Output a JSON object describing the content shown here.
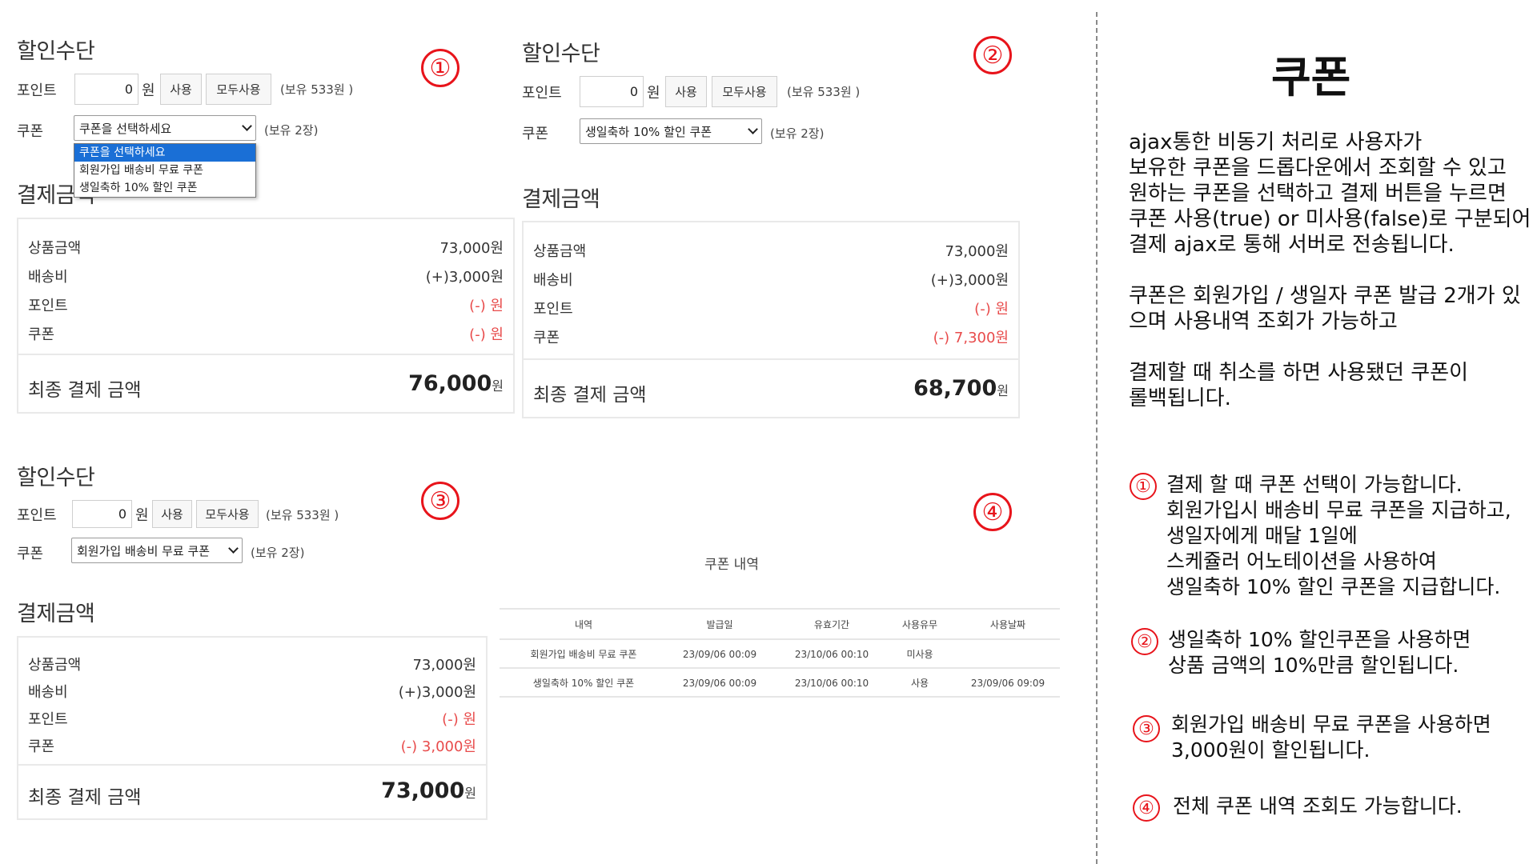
{
  "panel1": {
    "discount_title": "할인수단",
    "point_label": "포인트",
    "point_value": "0",
    "won": "원",
    "use_btn": "사용",
    "use_all_btn": "모두사용",
    "point_hold": "(보유 533원 )",
    "coupon_label": "쿠폰",
    "coupon_selected": "쿠폰을 선택하세요",
    "coupon_hold": "(보유 2장)",
    "dropdown_options": [
      "쿠폰을 선택하세요",
      "회원가입 배송비 무료 쿠폰",
      "생일축하 10% 할인 쿠폰"
    ],
    "payment_title": "결제금액",
    "rows": [
      {
        "label": "상품금액",
        "value": "73,000원"
      },
      {
        "label": "배송비",
        "value": "(+)3,000원"
      },
      {
        "label": "포인트",
        "value": "(-) 원"
      },
      {
        "label": "쿠폰",
        "value": "(-) 원"
      }
    ],
    "final_label": "최종 결제 금액",
    "final_amount": "76,000",
    "final_unit": "원"
  },
  "panel2": {
    "discount_title": "할인수단",
    "point_label": "포인트",
    "point_value": "0",
    "won": "원",
    "use_btn": "사용",
    "use_all_btn": "모두사용",
    "point_hold": "(보유 533원 )",
    "coupon_label": "쿠폰",
    "coupon_selected": "생일축하 10% 할인 쿠폰",
    "coupon_hold": "(보유 2장)",
    "payment_title": "결제금액",
    "rows": [
      {
        "label": "상품금액",
        "value": "73,000원"
      },
      {
        "label": "배송비",
        "value": "(+)3,000원"
      },
      {
        "label": "포인트",
        "value": "(-) 원"
      },
      {
        "label": "쿠폰",
        "value": "(-) 7,300원"
      }
    ],
    "final_label": "최종 결제 금액",
    "final_amount": "68,700",
    "final_unit": "원"
  },
  "panel3": {
    "discount_title": "할인수단",
    "point_label": "포인트",
    "point_value": "0",
    "won": "원",
    "use_btn": "사용",
    "use_all_btn": "모두사용",
    "point_hold": "(보유 533원 )",
    "coupon_label": "쿠폰",
    "coupon_selected": "회원가입 배송비 무료 쿠폰",
    "coupon_hold": "(보유 2장)",
    "payment_title": "결제금액",
    "rows": [
      {
        "label": "상품금액",
        "value": "73,000원"
      },
      {
        "label": "배송비",
        "value": "(+)3,000원"
      },
      {
        "label": "포인트",
        "value": "(-) 원"
      },
      {
        "label": "쿠폰",
        "value": "(-) 3,000원"
      }
    ],
    "final_label": "최종 결제 금액",
    "final_amount": "73,000",
    "final_unit": "원"
  },
  "history": {
    "title": "쿠폰 내역",
    "headers": [
      "내역",
      "발급일",
      "유효기간",
      "사용유무",
      "사용날짜"
    ],
    "rows": [
      [
        "회원가입 배송비 무료 쿠폰",
        "23/09/06 00:09",
        "23/10/06 00:10",
        "미사용",
        ""
      ],
      [
        "생일축하 10% 할인 쿠폰",
        "23/09/06 00:09",
        "23/10/06 00:10",
        "사용",
        "23/09/06 09:09"
      ]
    ]
  },
  "markers": [
    "①",
    "②",
    "③",
    "④"
  ],
  "description": {
    "title": "쿠폰",
    "para1": "ajax통한 비동기 처리로 사용자가\n보유한 쿠폰을 드롭다운에서 조회할 수 있고\n원하는 쿠폰을 선택하고 결제 버튼을 누르면\n쿠폰 사용(true) or 미사용(false)로 구분되어\n결제 ajax로 통해 서버로 전송됩니다.",
    "para2": "쿠폰은 회원가입 / 생일자 쿠폰 발급 2개가 있\n으며 사용내역 조회가 가능하고",
    "para3": "결제할 때 취소를 하면 사용됐던 쿠폰이\n롤백됩니다.",
    "notes": [
      "결제 할 때 쿠폰 선택이 가능합니다.\n회원가입시 배송비 무료 쿠폰을 지급하고,\n생일자에게 매달 1일에\n스케쥴러 어노테이션을 사용하여\n생일축하 10% 할인 쿠폰을 지급합니다.",
      "생일축하 10% 할인쿠폰을 사용하면\n상품 금액의 10%만큼 할인됩니다.",
      "회원가입 배송비 무료 쿠폰을 사용하면\n3,000원이 할인됩니다.",
      "전체 쿠폰 내역 조회도 가능합니다."
    ]
  },
  "colors": {
    "accent_red": "#e8141b",
    "discount_red": "#e84b4b",
    "select_blue": "#1a6fd6"
  }
}
